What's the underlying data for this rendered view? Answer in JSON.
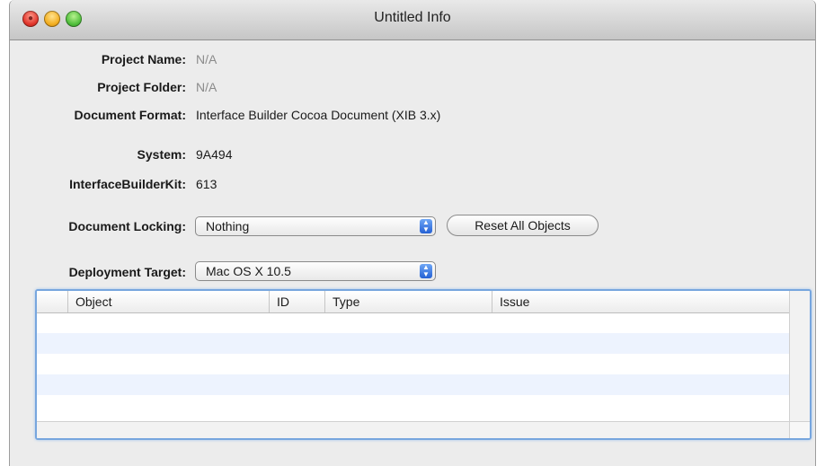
{
  "window": {
    "title": "Untitled Info"
  },
  "info": {
    "project_name_label": "Project Name:",
    "project_name_value": "N/A",
    "project_folder_label": "Project Folder:",
    "project_folder_value": "N/A",
    "document_format_label": "Document Format:",
    "document_format_value": "Interface Builder Cocoa Document (XIB 3.x)",
    "system_label": "System:",
    "system_value": "9A494",
    "ibkit_label": "InterfaceBuilderKit:",
    "ibkit_value": "613"
  },
  "locking": {
    "label": "Document Locking:",
    "selected": "Nothing",
    "reset_button": "Reset All Objects"
  },
  "deployment": {
    "label": "Deployment Target:",
    "selected": "Mac OS X 10.5"
  },
  "issues_table": {
    "columns": [
      "Object",
      "ID",
      "Type",
      "Issue"
    ],
    "rows": []
  },
  "colors": {
    "focus_ring": "#77a6de",
    "alt_row": "#edf3fe",
    "popup_arrows": "#2561d4"
  }
}
